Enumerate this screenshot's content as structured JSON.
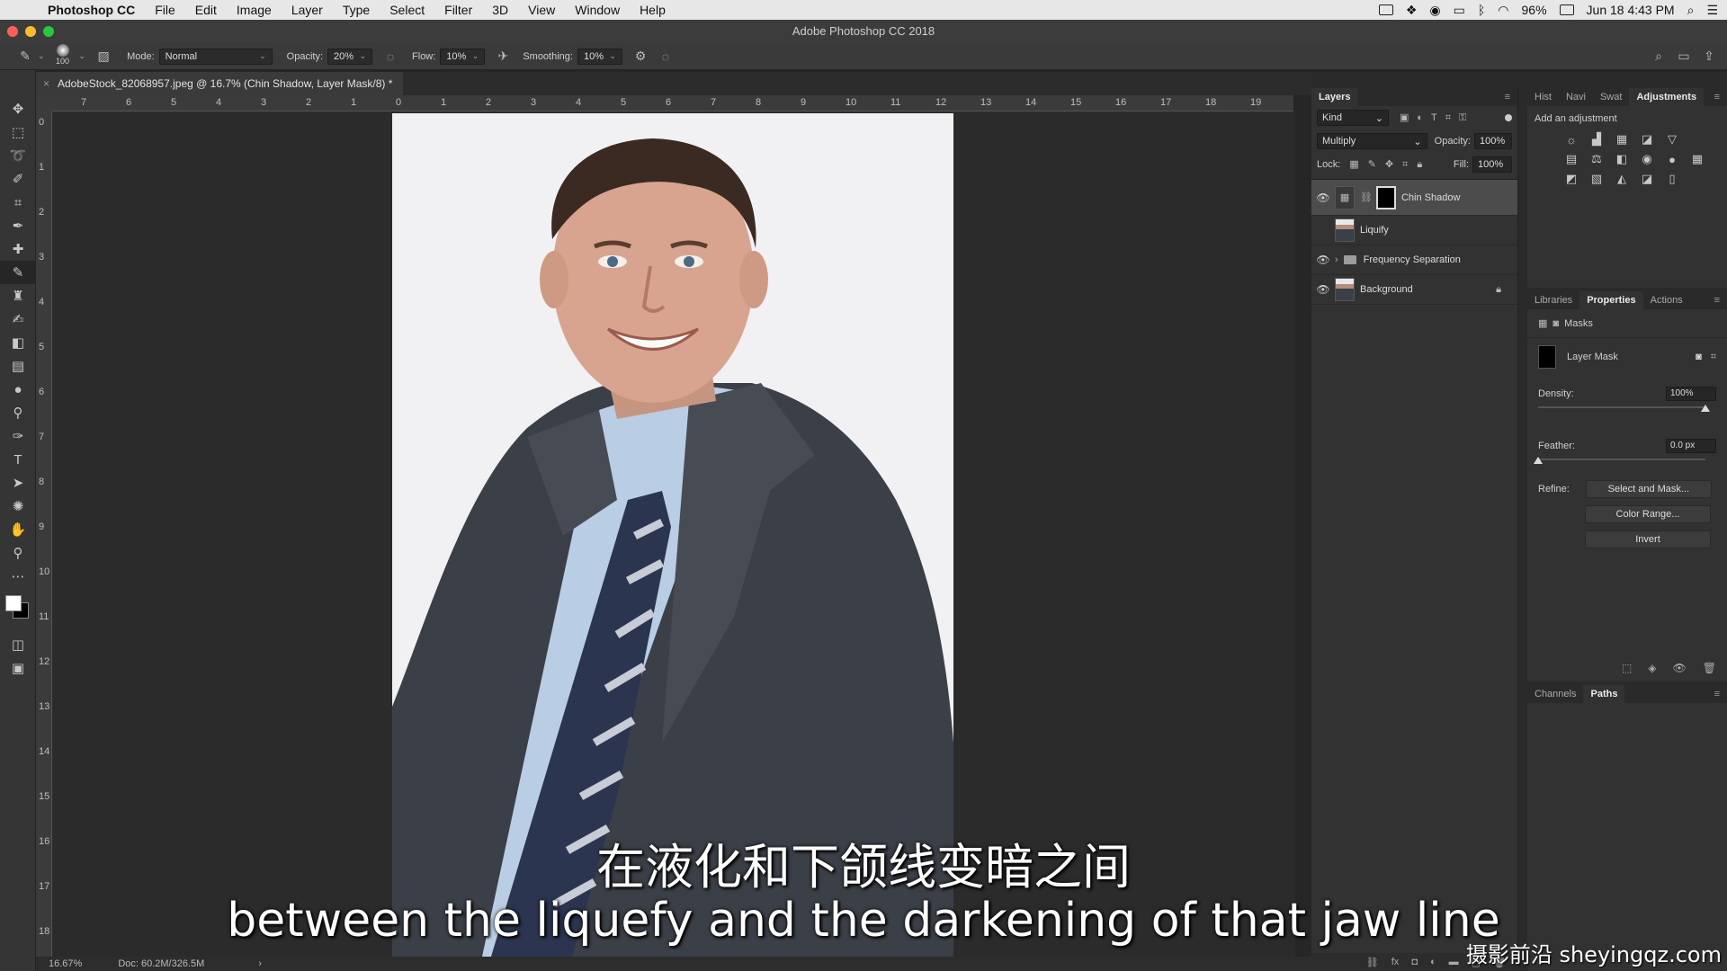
{
  "menubar": {
    "app": "Photoshop CC",
    "items": [
      "File",
      "Edit",
      "Image",
      "Layer",
      "Type",
      "Select",
      "Filter",
      "3D",
      "View",
      "Window",
      "Help"
    ],
    "battery": "96%",
    "datetime": "Jun 18  4:43 PM"
  },
  "window": {
    "title": "Adobe Photoshop CC 2018"
  },
  "options": {
    "brush_size": "100",
    "mode_label": "Mode:",
    "mode_value": "Normal",
    "opacity_label": "Opacity:",
    "opacity_value": "20%",
    "flow_label": "Flow:",
    "flow_value": "10%",
    "smoothing_label": "Smoothing:",
    "smoothing_value": "10%"
  },
  "document": {
    "tab_title": "AdobeStock_82068957.jpeg @ 16.7% (Chin Shadow, Layer Mask/8) *",
    "zoom": "16.67%",
    "doc_size": "Doc: 60.2M/326.5M"
  },
  "ruler": {
    "h_labels": [
      "7",
      "6",
      "5",
      "4",
      "3",
      "2",
      "1",
      "0",
      "1",
      "2",
      "3",
      "4",
      "5",
      "6",
      "7",
      "8",
      "9",
      "10",
      "11",
      "12",
      "13",
      "14",
      "15",
      "16",
      "17",
      "18",
      "19"
    ],
    "v_labels": [
      "0",
      "1",
      "2",
      "3",
      "4",
      "5",
      "6",
      "7",
      "8",
      "9",
      "10",
      "11",
      "12",
      "13",
      "14",
      "15",
      "16",
      "17",
      "18"
    ]
  },
  "layers_panel": {
    "tab": "Layers",
    "kind": "Kind",
    "blend_mode": "Multiply",
    "opacity_label": "Opacity:",
    "opacity_value": "100%",
    "lock_label": "Lock:",
    "fill_label": "Fill:",
    "fill_value": "100%",
    "layers": [
      {
        "name": "Chin Shadow",
        "visible": true,
        "selected": true
      },
      {
        "name": "Liquify",
        "visible": false
      },
      {
        "name": "Frequency Separation",
        "visible": true
      },
      {
        "name": "Background",
        "visible": true
      }
    ]
  },
  "adjustments_panel": {
    "tabs": [
      "Hist",
      "Navi",
      "Swat",
      "Adjustments"
    ],
    "heading": "Add an adjustment"
  },
  "properties_panel": {
    "tabs": [
      "Libraries",
      "Properties",
      "Actions"
    ],
    "masks_label": "Masks",
    "layer_mask_label": "Layer Mask",
    "density_label": "Density:",
    "density_value": "100%",
    "feather_label": "Feather:",
    "feather_value": "0.0 px",
    "refine_label": "Refine:",
    "select_and_mask": "Select and Mask...",
    "color_range": "Color Range...",
    "invert": "Invert"
  },
  "channels_panel": {
    "tabs": [
      "Channels",
      "Paths"
    ]
  },
  "subtitles": {
    "cn": "在液化和下颌线变暗之间",
    "en": "between the liquefy and the darkening of that jaw line"
  },
  "watermark": "摄影前沿 sheyingqz.com",
  "colors": {
    "accent_traffic_red": "#fc5f57",
    "accent_traffic_yellow": "#fdbc2e",
    "accent_traffic_green": "#28c840"
  }
}
